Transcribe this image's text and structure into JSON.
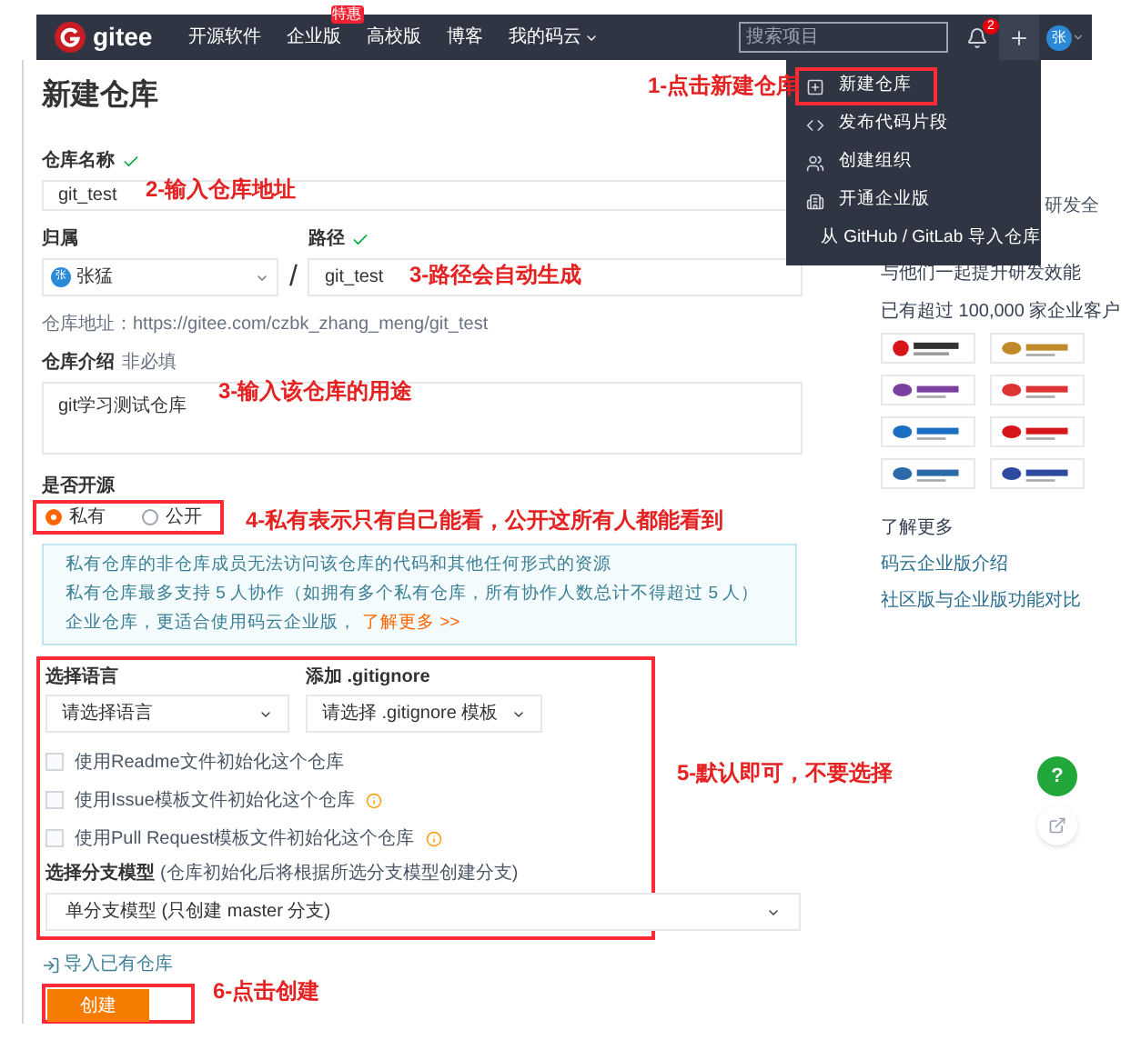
{
  "nav": {
    "logo": "gitee",
    "items": [
      {
        "label": "开源软件"
      },
      {
        "label": "企业版",
        "badge": "特惠"
      },
      {
        "label": "高校版"
      },
      {
        "label": "博客"
      },
      {
        "label": "我的码云",
        "dropdown": true
      }
    ],
    "search": {
      "placeholder": "搜索项目"
    },
    "notifications": "2",
    "avatar": "张"
  },
  "page_title": "新建仓库",
  "form": {
    "name": {
      "label": "仓库名称",
      "valid": true,
      "value": "git_test"
    },
    "owner": {
      "label": "归属",
      "avatar": "张",
      "value": "张猛"
    },
    "separator": "/",
    "path": {
      "label": "路径",
      "valid": true,
      "value": "git_test"
    },
    "address": "仓库地址：https://gitee.com/czbk_zhang_meng/git_test",
    "description": {
      "label": "仓库介绍",
      "hint": "非必填",
      "value": "git学习测试仓库"
    },
    "visibility": {
      "label": "是否开源",
      "options": [
        {
          "label": "私有",
          "selected": true
        },
        {
          "label": "公开",
          "selected": false
        }
      ]
    },
    "notice": [
      "私有仓库的非仓库成员无法访问该仓库的代码和其他任何形式的资源",
      "私有仓库最多支持 5 人协作（如拥有多个私有仓库，所有协作人数总计不得超过 5 人）",
      "企业仓库，更适合使用码云企业版，"
    ],
    "notice_link": "了解更多 >>",
    "language": {
      "label": "选择语言",
      "value": "请选择语言"
    },
    "gitignore": {
      "label": "添加 .gitignore",
      "value": "请选择 .gitignore 模板"
    },
    "checkboxes": [
      {
        "label": "使用Readme文件初始化这个仓库",
        "checked": false,
        "info": false
      },
      {
        "label": "使用Issue模板文件初始化这个仓库",
        "checked": false,
        "info": true
      },
      {
        "label": "使用Pull Request模板文件初始化这个仓库",
        "checked": false,
        "info": true
      }
    ],
    "branch_model": {
      "label": "选择分支模型",
      "hint": "(仓库初始化后将根据所选分支模型创建分支)",
      "value": "单分支模型 (只创建 master 分支)"
    },
    "import_link": "导入已有仓库",
    "create_button": "创建"
  },
  "new_menu": [
    {
      "kind": "plus",
      "label": "新建仓库",
      "selected": true
    },
    {
      "kind": "code",
      "label": "发布代码片段",
      "selected": false
    },
    {
      "kind": "group",
      "label": "创建组织",
      "selected": false
    },
    {
      "kind": "building",
      "label": "开通企业版",
      "selected": false
    },
    {
      "kind": "github",
      "label": "从 GitHub / GitLab 导入仓库",
      "selected": false
    }
  ],
  "sidebar": {
    "cut_text": "研发全",
    "headline": "与他们一起提升研发效能",
    "customers": "已有超过 100,000 家企业客户",
    "learn_more": "了解更多",
    "links": [
      "码云企业版介绍",
      "社区版与企业版功能对比"
    ]
  },
  "help_button": "?",
  "annotations": [
    "1-点击新建仓库",
    "2-输入仓库地址",
    "3-路径会自动生成",
    "3-输入该仓库的用途",
    "4-私有表示只有自己能看，公开这所有人都能看到",
    "5-默认即可，不要选择",
    "6-点击创建"
  ]
}
